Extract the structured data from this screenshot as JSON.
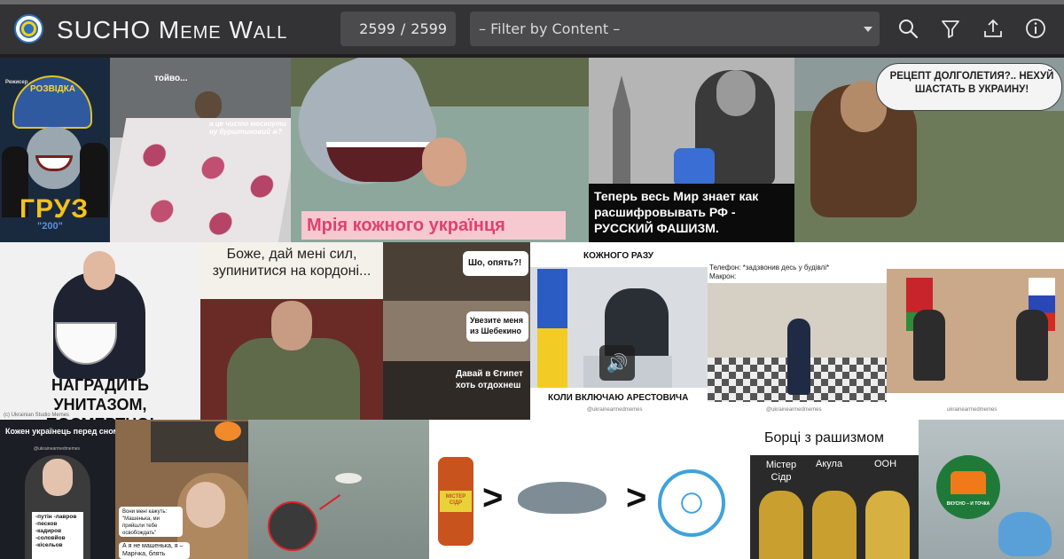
{
  "app": {
    "title_main": "SUCHO ",
    "title_meme": "Meme Wall",
    "counter_current": "2599",
    "counter_separator": "/",
    "counter_total": "2599",
    "filter_label": "– Filter by Content –"
  },
  "toolbar": {
    "icons": [
      "search-icon",
      "filter-icon",
      "upload-icon",
      "info-icon"
    ]
  },
  "memes": {
    "m1": {
      "top": "Режисер",
      "main": "ГРУЗ",
      "sub": "\"200\"",
      "emblem": "РОЗВІДКА"
    },
    "m2": {
      "top": "тойво...",
      "speech": "а це чисто москоути ну бурштиновий ж?"
    },
    "m3": {
      "caption": "Мрія кожного українця"
    },
    "m4": {
      "caption": "Теперь весь Мир  знает как расшифровывать РФ - РУССКИЙ ФАШИЗМ."
    },
    "m5": {
      "caption": "РЕЦЕПТ ДОЛГОЛЕТИЯ?.. НЕХУЙ ШАСТАТЬ В УКРАИНУ!"
    },
    "m6": {
      "caption": "НАГРАДИТЬ УНИТАЗОМ, ПОСМЕРТНО!",
      "footer": "(с) Ukrainian Studio Memes"
    },
    "m7": {
      "caption": "Боже, дай мені сил, зупинитися на кордоні..."
    },
    "m8": {
      "bubble1": "Шо, опять?!",
      "bubble2": "Увезите меня из Шебекино",
      "bubble3": "Давай в Єгипет хоть отдохнеш"
    },
    "m9": {
      "top": "КОЖНОГО РАЗУ",
      "bottom": "КОЛИ ВКЛЮЧАЮ АРЕСТОВИЧА",
      "watermark": "@ukrainearmedmemes"
    },
    "m10": {
      "line1": "Телефон: *задзвонив десь у будівлі*",
      "line2": "Макрон:",
      "watermark": "@ukrainearmedmemes"
    },
    "m11": {
      "watermark": "ukrainearmedmemes"
    },
    "m12": {
      "caption": "Кожен українець перед сном",
      "list": "-путін -лавров -песков -кадиров -соловйов -кісельов",
      "watermark": "@ukrainearmedmemes"
    },
    "m13": {
      "bubble": "Вони мені кажуть: \"Машенька, ми прийшли тебе освобождать\"",
      "reply": "А я не машенька, я – Марічка, блять"
    },
    "m15": {
      "gt1": ">",
      "gt2": ">",
      "bottle": "МІСТЕР СІДР"
    },
    "m16": {
      "title": "Борці з рашизмом",
      "label1": "Містер Сідр",
      "label2": "Акула",
      "label3": "ООН"
    },
    "m17": {
      "logo_text": "ВКУСНО – И ТОЧКА"
    }
  }
}
